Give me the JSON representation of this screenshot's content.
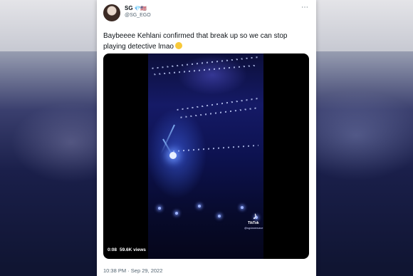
{
  "tweet": {
    "display_name": "SG",
    "badges": "💎🇺🇸",
    "handle": "@SG_EGO",
    "more_icon": "⋯",
    "text": "Baybeeee Kehlani confirmed that break up so we can stop playing detective lmao",
    "media": {
      "tiktok_label": "TikTok",
      "tiktok_user": "@sgdanewave",
      "duration": "0:08",
      "views": "59.6K views"
    },
    "timestamp": "10:38 PM · Sep 29, 2022"
  }
}
